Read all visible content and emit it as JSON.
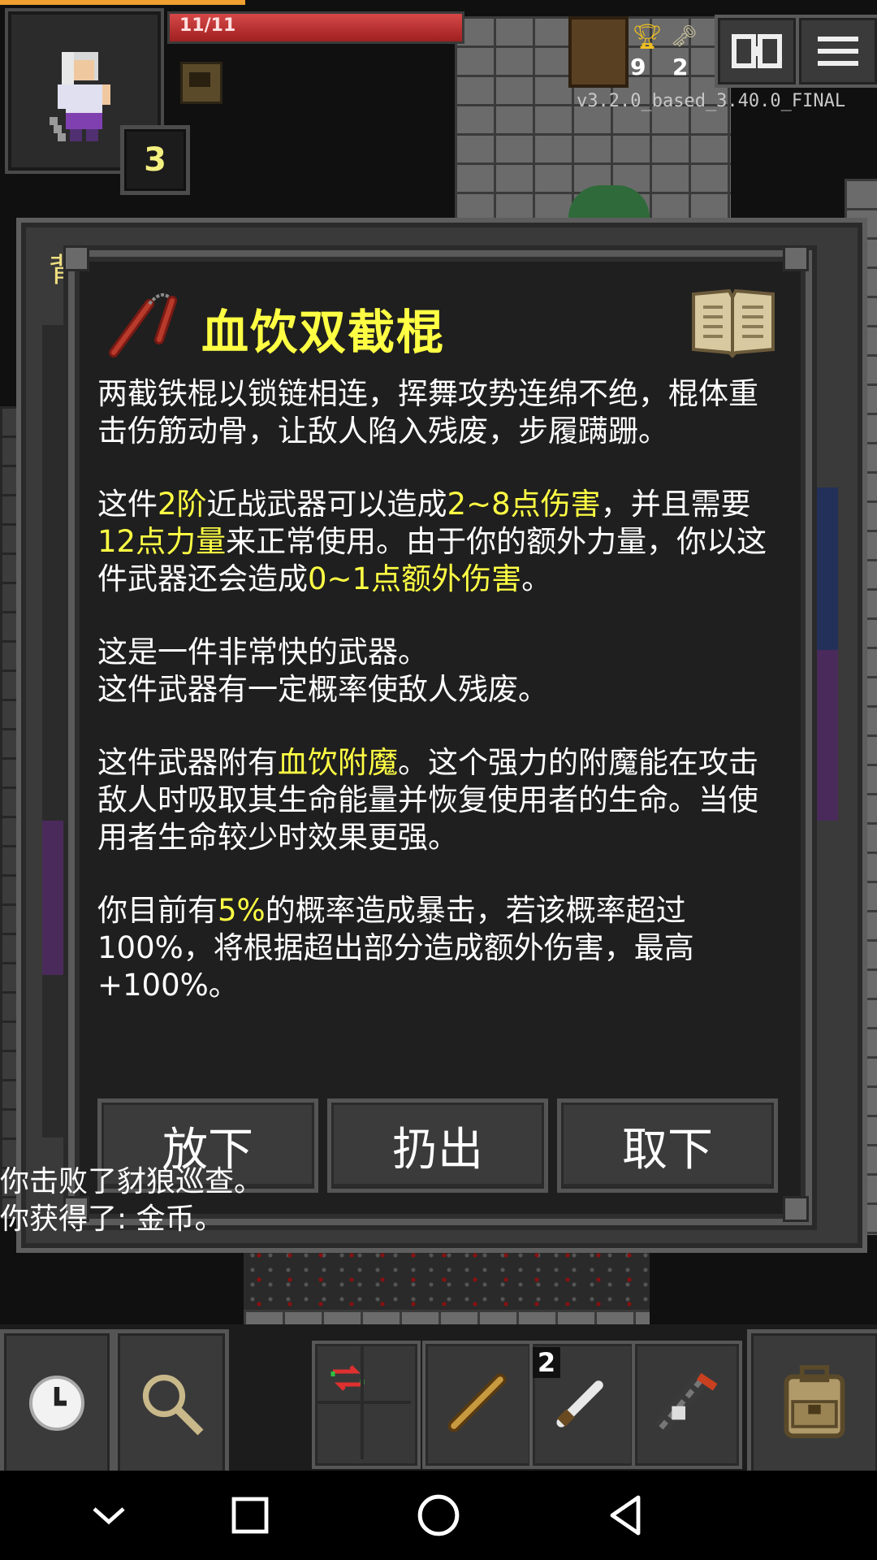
{
  "hud": {
    "hp_text": "11/11",
    "hp_fraction": 1.0,
    "xp_fraction": 0.28,
    "level": "3",
    "gold_count": "9",
    "key_count": "2",
    "version": "v3.2.0_based_3.40.0_FINAL",
    "buttons": {
      "journal_icon": "journal-icon",
      "menu_icon": "menu-icon"
    }
  },
  "backpack": {
    "title_fragment": "背"
  },
  "item_window": {
    "title": "血饮双截棍",
    "icon": "nunchaku-icon",
    "paragraphs": [
      [
        {
          "t": "两截铁棍以锁链相连，挥舞攻势连绵不绝，棍体重击伤筋动骨，让敌人陷入残废，步履蹒跚。",
          "h": false
        }
      ],
      [
        {
          "t": "这件",
          "h": false
        },
        {
          "t": "2阶",
          "h": true
        },
        {
          "t": "近战武器可以造成",
          "h": false
        },
        {
          "t": "2~8点伤害",
          "h": true
        },
        {
          "t": "，并且需要",
          "h": false
        },
        {
          "t": "12点力量",
          "h": true
        },
        {
          "t": "来正常使用。由于你的额外力量，你以这件武器还会造成",
          "h": false
        },
        {
          "t": "0~1点额外伤害",
          "h": true
        },
        {
          "t": "。",
          "h": false
        }
      ],
      [
        {
          "t": "这是一件非常快的武器。\n这件武器有一定概率使敌人残废。",
          "h": false
        }
      ],
      [
        {
          "t": "这件武器附有",
          "h": false
        },
        {
          "t": "血饮附魔",
          "h": true
        },
        {
          "t": "。这个强力的附魔能在攻击敌人时吸取其生命能量并恢复使用者的生命。当使用者生命较少时效果更强。",
          "h": false
        }
      ],
      [
        {
          "t": "你目前有",
          "h": false
        },
        {
          "t": "5%",
          "h": true
        },
        {
          "t": "的概率造成暴击，若该概率超过100%，将根据超出部分造成额外伤害，最高+100%。",
          "h": false
        }
      ]
    ],
    "actions": [
      "放下",
      "扔出",
      "取下"
    ]
  },
  "log": {
    "line1": "你击败了豺狼巡查。",
    "line2": "你获得了: 金币。"
  },
  "toolbar": {
    "wait_icon": "clock-icon",
    "search_icon": "magnifier-icon",
    "swap_icon": "swap-icon",
    "quickslots": [
      "wand-icon",
      "dagger-icon",
      "crossbow-icon"
    ],
    "quickslot_2_count": "2",
    "inventory_icon": "backpack-icon"
  },
  "navbar": [
    "back-chevron-icon",
    "recents-square-icon",
    "home-circle-icon",
    "back-triangle-icon"
  ],
  "colors": {
    "highlight": "#ffff44",
    "hp": "#c83030",
    "panel": "#1f1f1f"
  }
}
